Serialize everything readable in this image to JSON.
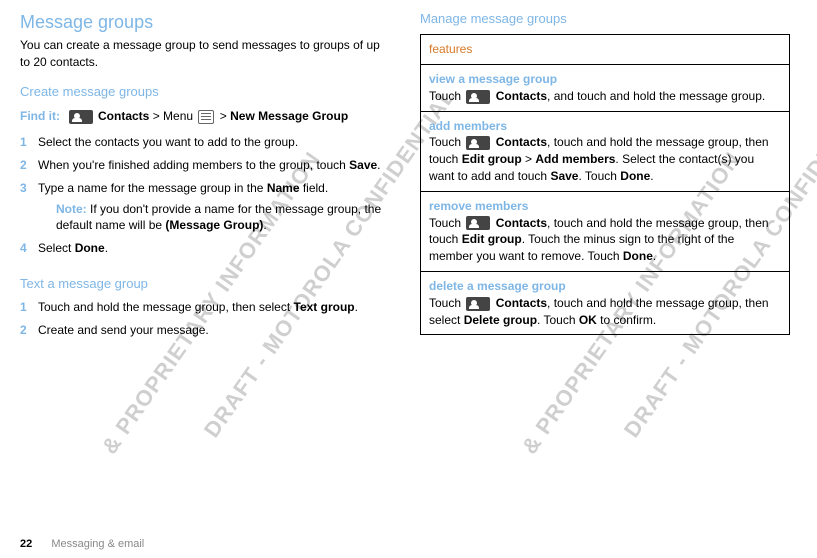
{
  "left": {
    "title": "Message groups",
    "intro": "You can create a message group to send messages to groups of up to 20 contacts.",
    "create_heading": "Create message groups",
    "findit_label": "Find it:",
    "contacts_label": "Contacts",
    "menu_word": "Menu",
    "gt1": ">",
    "gt2": ">",
    "new_msg_group": "New Message Group",
    "steps_create": [
      "Select the contacts you want to add to the group.",
      "When you're finished adding members to the group, touch ",
      "Type a name for the message group in the ",
      "Select "
    ],
    "save_word": "Save",
    "name_word": "Name",
    "name_tail": " field.",
    "note_label": "Note:",
    "note_text": " If you don't provide a name for the message group, the default name will be ",
    "note_bold": "(Message Group)",
    "done_word": "Done",
    "text_heading": "Text a message group",
    "steps_text": [
      "Touch and hold the message group, then select ",
      "Create and send your message."
    ],
    "text_group_bold": "Text group"
  },
  "right": {
    "manage_heading": "Manage message groups",
    "features_header": "features",
    "rows": {
      "view": {
        "title": "view a message group",
        "pre": "Touch ",
        "contacts": "Contacts",
        "post": ", and touch and hold the message group."
      },
      "add": {
        "title": "add members",
        "pre": "Touch ",
        "contacts": "Contacts",
        "mid1": ", touch and hold the message group, then touch ",
        "edit": "Edit group",
        "gt": " > ",
        "addm": "Add members",
        "mid2": ". Select the contact(s) you want to add and touch ",
        "save": "Save",
        "mid3": ". Touch ",
        "done": "Done",
        "end": "."
      },
      "remove": {
        "title": "remove members",
        "pre": "Touch ",
        "contacts": "Contacts",
        "mid1": ", touch and hold the message group, then touch ",
        "edit": "Edit group",
        "mid2": ". Touch the minus sign to the right of the member you want to remove. Touch ",
        "done": "Done",
        "end": "."
      },
      "delete": {
        "title": "delete a message group",
        "pre": "Touch ",
        "contacts": "Contacts",
        "mid1": ", touch and hold the message group, then select ",
        "del": "Delete group",
        "mid2": ". Touch ",
        "ok": "OK",
        "end": " to confirm."
      }
    }
  },
  "footer": {
    "page": "22",
    "section": "Messaging & email"
  },
  "watermarks": {
    "conf": "DRAFT - MOTOROLA CONFIDENTIAL",
    "prop": "& PROPRIETARY INFORMATION"
  }
}
